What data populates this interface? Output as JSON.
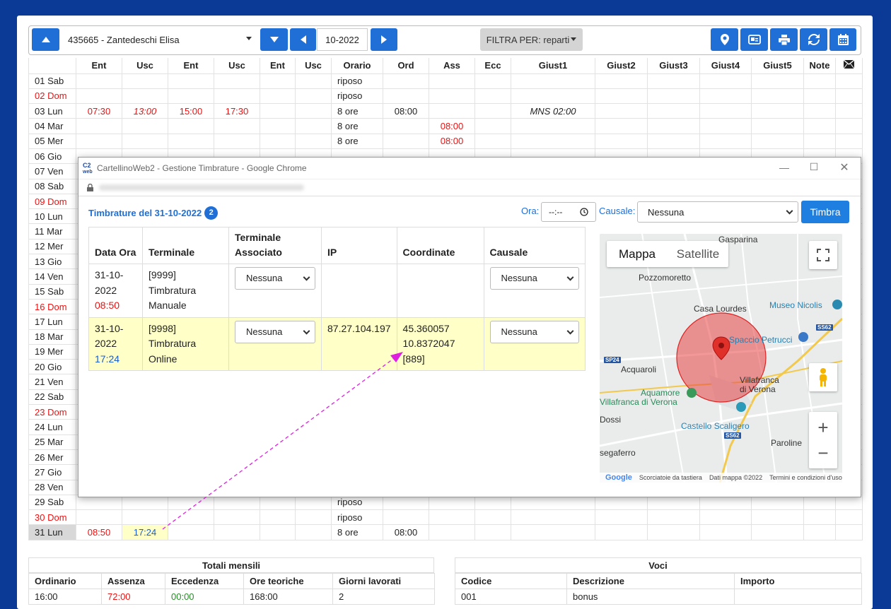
{
  "toolbar": {
    "employee": "435665 - Zantedeschi Elisa",
    "month": "10-2022",
    "filter_label": "FILTRA PER: reparti"
  },
  "grid": {
    "headers": [
      "Ent",
      "Usc",
      "Ent",
      "Usc",
      "Ent",
      "Usc",
      "Orario",
      "Ord",
      "Ass",
      "Ecc",
      "Giust1",
      "Giust2",
      "Giust3",
      "Giust4",
      "Giust5",
      "Note"
    ],
    "days": [
      {
        "day": "01 Sab",
        "holiday": false,
        "orario": "riposo"
      },
      {
        "day": "02 Dom",
        "holiday": true,
        "orario": "riposo"
      },
      {
        "day": "03 Lun",
        "holiday": false,
        "ent1": "07:30",
        "usc1": "13:00",
        "ent2": "15:00",
        "usc2": "17:30",
        "orario": "8 ore",
        "ord": "08:00",
        "giust1": "MNS 02:00"
      },
      {
        "day": "04 Mar",
        "holiday": false,
        "orario": "8 ore",
        "ass": "08:00"
      },
      {
        "day": "05 Mer",
        "holiday": false,
        "orario": "8 ore",
        "ass": "08:00"
      },
      {
        "day": "06 Gio",
        "holiday": false
      },
      {
        "day": "07 Ven",
        "holiday": false
      },
      {
        "day": "08 Sab",
        "holiday": false
      },
      {
        "day": "09 Dom",
        "holiday": true
      },
      {
        "day": "10 Lun",
        "holiday": false
      },
      {
        "day": "11 Mar",
        "holiday": false
      },
      {
        "day": "12 Mer",
        "holiday": false
      },
      {
        "day": "13 Gio",
        "holiday": false
      },
      {
        "day": "14 Ven",
        "holiday": false
      },
      {
        "day": "15 Sab",
        "holiday": false
      },
      {
        "day": "16 Dom",
        "holiday": true
      },
      {
        "day": "17 Lun",
        "holiday": false
      },
      {
        "day": "18 Mar",
        "holiday": false
      },
      {
        "day": "19 Mer",
        "holiday": false
      },
      {
        "day": "20 Gio",
        "holiday": false
      },
      {
        "day": "21 Ven",
        "holiday": false
      },
      {
        "day": "22 Sab",
        "holiday": false
      },
      {
        "day": "23 Dom",
        "holiday": true
      },
      {
        "day": "24 Lun",
        "holiday": false
      },
      {
        "day": "25 Mar",
        "holiday": false
      },
      {
        "day": "26 Mer",
        "holiday": false
      },
      {
        "day": "27 Gio",
        "holiday": false
      },
      {
        "day": "28 Ven",
        "holiday": false
      },
      {
        "day": "29 Sab",
        "holiday": false,
        "orario": "riposo"
      },
      {
        "day": "30 Dom",
        "holiday": true,
        "orario": "riposo"
      },
      {
        "day": "31 Lun",
        "holiday": false,
        "selected": true,
        "ent1": "08:50",
        "usc1": "17:24",
        "orario": "8 ore",
        "ord": "08:00"
      }
    ]
  },
  "totals": {
    "title": "Totali mensili",
    "headers": [
      "Ordinario",
      "Assenza",
      "Eccedenza",
      "Ore teoriche",
      "Giorni lavorati"
    ],
    "values": [
      "16:00",
      "72:00",
      "00:00",
      "168:00",
      "2"
    ]
  },
  "voci": {
    "title": "Voci",
    "headers": [
      "Codice",
      "Descrizione",
      "Importo"
    ],
    "values": [
      "001",
      "bonus",
      ""
    ]
  },
  "popup": {
    "window_title": "CartellinoWeb2 - Gestione Timbrature - Google Chrome",
    "heading": "Timbrature del 31-10-2022",
    "count": "2",
    "ora_label": "Ora:",
    "ora_placeholder": "--:--",
    "causale_label": "Causale:",
    "causale_value": "Nessuna",
    "timbra_label": "Timbra",
    "table_headers": {
      "data_ora": "Data Ora",
      "terminale": "Terminale",
      "terminale_associato": "Terminale Associato",
      "ip": "IP",
      "coordinate": "Coordinate",
      "causale": "Causale"
    },
    "rows": [
      {
        "date": "31-10-2022",
        "time": "08:50",
        "terminal": "[9999] Timbratura Manuale",
        "associated": "Nessuna",
        "ip": "",
        "coordinates": "",
        "causale": "Nessuna"
      },
      {
        "date": "31-10-2022",
        "time": "17:24",
        "terminal": "[9998] Timbratura Online",
        "associated": "Nessuna",
        "ip": "87.27.104.197",
        "coordinates": "45.360057 10.8372047 [889]",
        "causale": "Nessuna"
      }
    ]
  },
  "map": {
    "tab_map": "Mappa",
    "tab_satellite": "Satellite",
    "labels": {
      "gasparina": "Gasparina",
      "pozzomoretto": "Pozzomoretto",
      "casa_lourdes": "Casa Lourdes",
      "museo": "Museo Nicolis",
      "spaccio": "Spaccio Petrucci",
      "acquaroli": "Acquaroli",
      "aquamore": "Aquamore",
      "villafranca_left": "Villafranca di Verona",
      "villafranca": "Villafranca di Verona",
      "castello": "Castello Scaligero",
      "paroline": "Paroline",
      "dossi": "Dossi",
      "segaferro": "segaferro",
      "road_ss62": "SS62",
      "road_sp24": "SP24"
    },
    "footer": {
      "shortcuts": "Scorciatoie da tastiera",
      "data": "Dati mappa ©2022",
      "terms": "Termini e condizioni d'uso",
      "google": "Google"
    },
    "marker_color": "#e0302a",
    "radius_color": "#e84444"
  },
  "colors": {
    "background": "#0a3a96",
    "accent": "#1f6fd6",
    "holiday": "#e11111",
    "highlight": "#ffffc8"
  }
}
